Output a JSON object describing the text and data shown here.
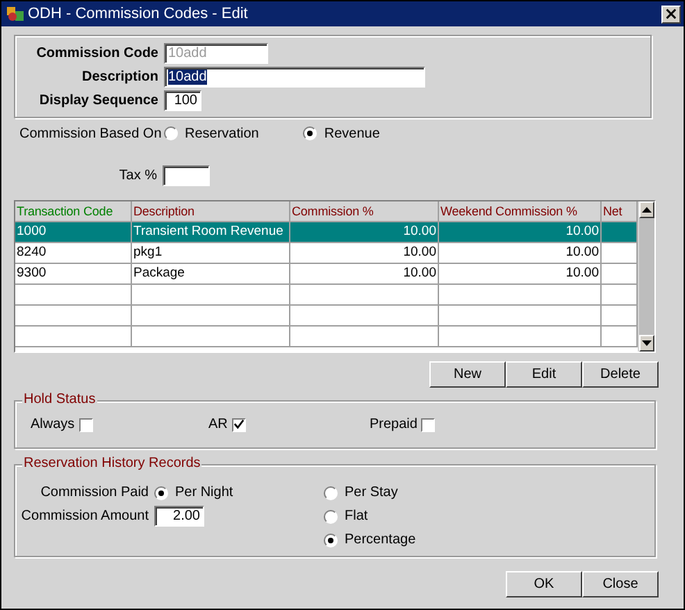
{
  "window": {
    "title": "ODH - Commission Codes - Edit"
  },
  "header_fields": [
    {
      "label": "Commission Code",
      "value": "10add",
      "kind": "text",
      "disabled": true,
      "highlighted": false
    },
    {
      "label": "Description",
      "value": "10add",
      "kind": "text",
      "disabled": false,
      "highlighted": true
    },
    {
      "label": "Display Sequence",
      "value": "100",
      "kind": "number",
      "disabled": false,
      "highlighted": false
    }
  ],
  "commission_based_on": {
    "label": "Commission Based On",
    "options": [
      {
        "label": "Reservation",
        "selected": false
      },
      {
        "label": "Revenue",
        "selected": true
      }
    ]
  },
  "tax": {
    "label": "Tax %"
  },
  "table": {
    "columns": [
      {
        "label": "Transaction Code",
        "color": "#008000",
        "kind": "text"
      },
      {
        "label": "Description",
        "color": "#800000",
        "kind": "text"
      },
      {
        "label": "Commission %",
        "color": "#800000",
        "kind": "number"
      },
      {
        "label": "Weekend Commission %",
        "color": "#800000",
        "kind": "number"
      },
      {
        "label": "Net",
        "color": "#800000",
        "kind": "text"
      }
    ],
    "rows": [
      {
        "cells": [
          "1000",
          "Transient Room Revenue",
          "10.00",
          "10.00"
        ],
        "selected": true
      },
      {
        "cells": [
          "8240",
          "pkg1",
          "10.00",
          "10.00"
        ],
        "selected": false
      },
      {
        "cells": [
          "9300",
          "Package",
          "10.00",
          "10.00"
        ],
        "selected": false
      }
    ]
  },
  "table_buttons": [
    "New",
    "Edit",
    "Delete"
  ],
  "hold_status": {
    "title": "Hold Status",
    "items": [
      {
        "label": "Always",
        "checked": false
      },
      {
        "label": "AR",
        "checked": true
      },
      {
        "label": "Prepaid",
        "checked": false
      }
    ]
  },
  "history": {
    "title": "Reservation History Records",
    "commission_paid": {
      "label": "Commission Paid",
      "options": [
        {
          "label": "Per Night",
          "selected": true
        },
        {
          "label": "Per Stay",
          "selected": false
        }
      ]
    },
    "commission_amount": {
      "label": "Commission Amount",
      "value": "2.00"
    },
    "amount_options": [
      {
        "label": "Flat",
        "selected": false
      },
      {
        "label": "Percentage",
        "selected": true
      }
    ]
  },
  "buttons": [
    "OK",
    "Close"
  ]
}
